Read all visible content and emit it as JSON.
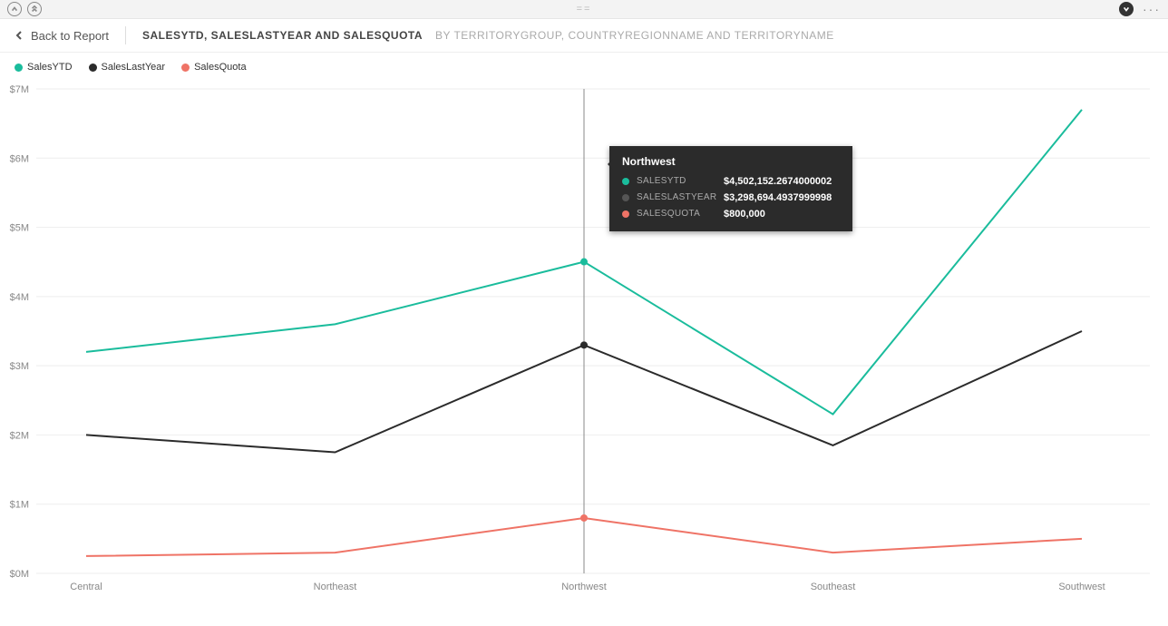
{
  "toolbar": {
    "grip": "=="
  },
  "header": {
    "back": "Back to Report",
    "title": "SALESYTD, SALESLASTYEAR AND SALESQUOTA",
    "subtitle": "BY TERRITORYGROUP, COUNTRYREGIONNAME AND TERRITORYNAME"
  },
  "legend": [
    {
      "label": "SalesYTD",
      "color": "#1abc9c"
    },
    {
      "label": "SalesLastYear",
      "color": "#2b2b2b"
    },
    {
      "label": "SalesQuota",
      "color": "#ef7366"
    }
  ],
  "tooltip": {
    "title": "Northwest",
    "rows": [
      {
        "series": "SALESYTD",
        "value": "$4,502,152.2674000002",
        "color": "#1abc9c"
      },
      {
        "series": "SALESLASTYEAR",
        "value": "$3,298,694.4937999998",
        "color": "#555"
      },
      {
        "series": "SALESQUOTA",
        "value": "$800,000",
        "color": "#ef7366"
      }
    ]
  },
  "chart_data": {
    "type": "line",
    "title": "SALESYTD, SALESLASTYEAR AND SALESQUOTA",
    "xlabel": "",
    "ylabel": "",
    "ylim": [
      0,
      7000000
    ],
    "y_ticks": [
      "$0M",
      "$1M",
      "$2M",
      "$3M",
      "$4M",
      "$5M",
      "$6M",
      "$7M"
    ],
    "categories": [
      "Central",
      "Northeast",
      "Northwest",
      "Southeast",
      "Southwest"
    ],
    "highlighted_category_index": 2,
    "series": [
      {
        "name": "SalesYTD",
        "color": "#1abc9c",
        "values": [
          3200000,
          3600000,
          4502152.2674,
          2300000,
          6700000
        ]
      },
      {
        "name": "SalesLastYear",
        "color": "#2b2b2b",
        "values": [
          2000000,
          1750000,
          3298694.4938,
          1850000,
          3500000
        ]
      },
      {
        "name": "SalesQuota",
        "color": "#ef7366",
        "values": [
          250000,
          300000,
          800000,
          300000,
          500000
        ]
      }
    ]
  }
}
